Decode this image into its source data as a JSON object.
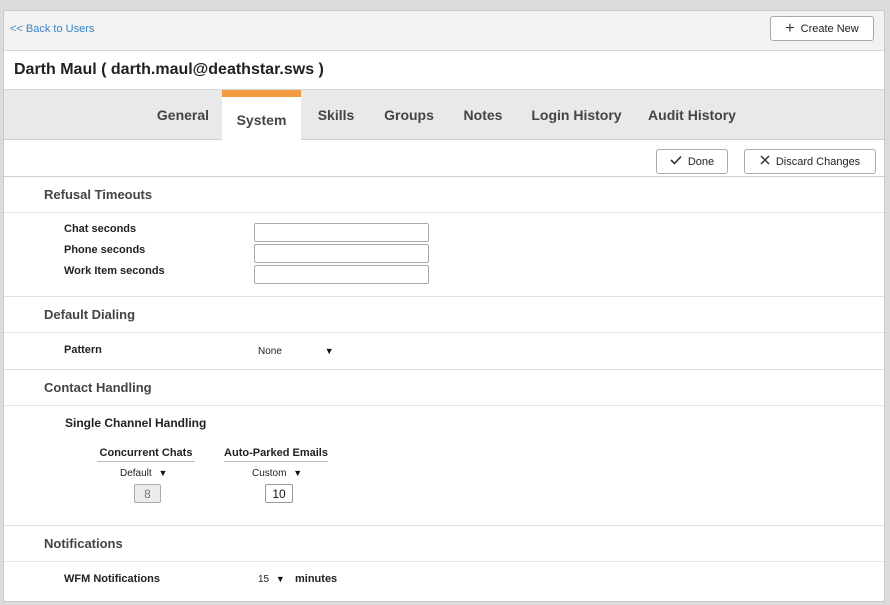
{
  "topbar": {
    "back_label": "<< Back to Users",
    "create_label": "Create New"
  },
  "user": {
    "title": "Darth Maul ( darth.maul@deathstar.sws )"
  },
  "tabs": [
    {
      "label": "General",
      "active": false
    },
    {
      "label": "System",
      "active": true
    },
    {
      "label": "Skills",
      "active": false
    },
    {
      "label": "Groups",
      "active": false
    },
    {
      "label": "Notes",
      "active": false
    },
    {
      "label": "Login History",
      "active": false
    },
    {
      "label": "Audit History",
      "active": false
    }
  ],
  "actions": {
    "done_label": "Done",
    "discard_label": "Discard Changes"
  },
  "refusal": {
    "heading": "Refusal Timeouts",
    "chat_label": "Chat seconds",
    "phone_label": "Phone seconds",
    "work_label": "Work Item seconds",
    "chat_value": "",
    "phone_value": "",
    "work_value": ""
  },
  "dialing": {
    "heading": "Default Dialing",
    "pattern_label": "Pattern",
    "pattern_value": "None"
  },
  "contact": {
    "heading": "Contact Handling",
    "sub_heading": "Single Channel Handling",
    "chats_header": "Concurrent Chats",
    "chats_mode": "Default",
    "chats_value": "8",
    "emails_header": "Auto-Parked Emails",
    "emails_mode": "Custom",
    "emails_value": "10"
  },
  "notifications": {
    "heading": "Notifications",
    "wfm_label": "WFM Notifications",
    "wfm_value": "15",
    "wfm_unit": "minutes"
  },
  "colors": {
    "accent": "#f39a43",
    "link": "#3a87c8"
  }
}
